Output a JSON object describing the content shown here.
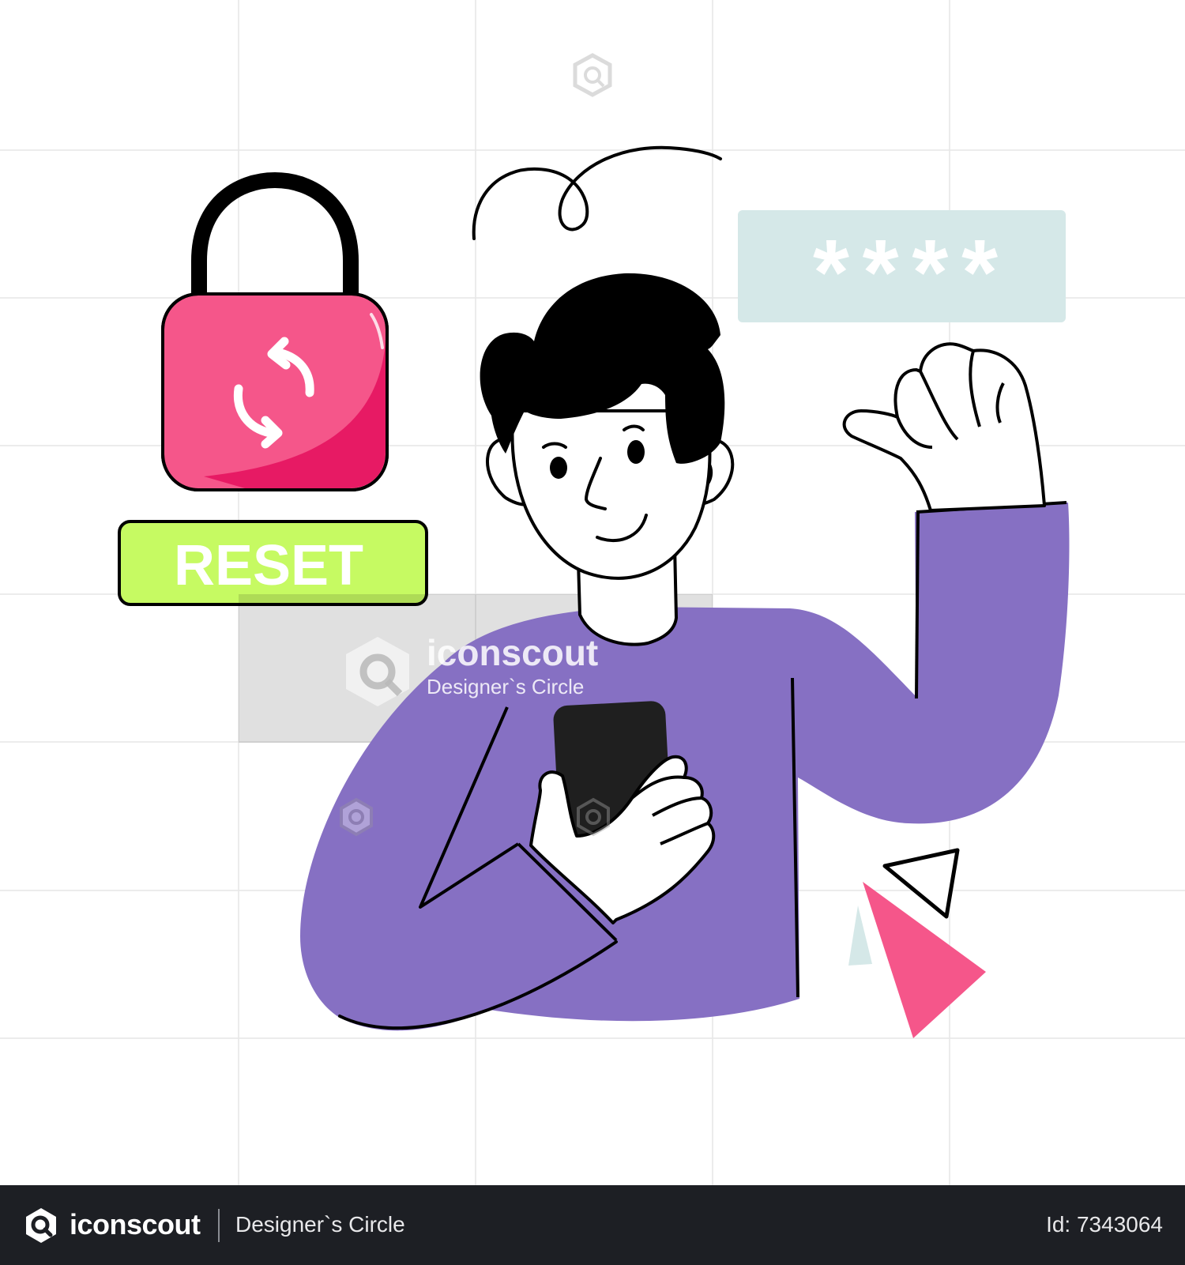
{
  "illustration": {
    "reset_label": "RESET",
    "password_mask": "* * * *",
    "colors": {
      "lock_body": "#f5568a",
      "lock_shade": "#e71a64",
      "reset_button": "#c6fa62",
      "password_box": "#d5e8e8",
      "sweater": "#8670c3",
      "triangle_pink": "#f5568a",
      "triangle_mint": "#d5e8e8",
      "ink": "#000000"
    },
    "icons": [
      "padlock-icon",
      "refresh-icon",
      "smartphone-icon"
    ]
  },
  "watermark": {
    "brand": "iconscout",
    "author": "Designer`s Circle"
  },
  "footer": {
    "brand": "iconscout",
    "author": "Designer`s Circle",
    "id_label": "Id: 7343064"
  }
}
